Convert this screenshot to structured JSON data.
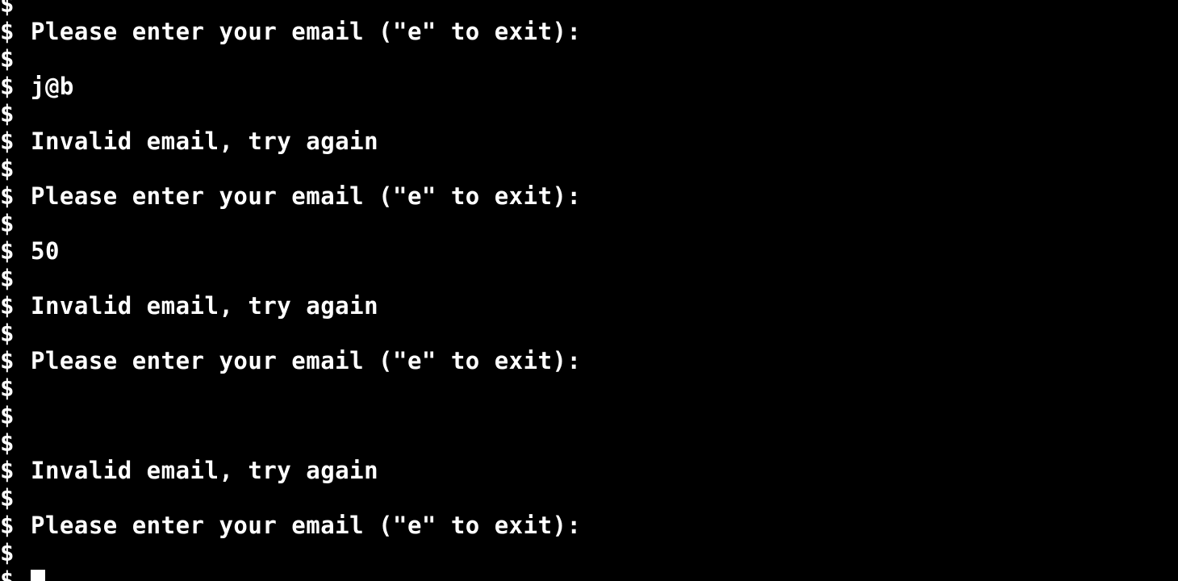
{
  "terminal": {
    "prompt_symbol": "$",
    "lines": [
      {
        "prompt": "$",
        "text": ""
      },
      {
        "prompt": "$",
        "text": "Please enter your email (\"e\" to exit):"
      },
      {
        "prompt": "$",
        "text": ""
      },
      {
        "prompt": "$",
        "text": "j@b"
      },
      {
        "prompt": "$",
        "text": ""
      },
      {
        "prompt": "$",
        "text": "Invalid email, try again"
      },
      {
        "prompt": "$",
        "text": ""
      },
      {
        "prompt": "$",
        "text": "Please enter your email (\"e\" to exit):"
      },
      {
        "prompt": "$",
        "text": ""
      },
      {
        "prompt": "$",
        "text": "50"
      },
      {
        "prompt": "$",
        "text": ""
      },
      {
        "prompt": "$",
        "text": "Invalid email, try again"
      },
      {
        "prompt": "$",
        "text": ""
      },
      {
        "prompt": "$",
        "text": "Please enter your email (\"e\" to exit):"
      },
      {
        "prompt": "$",
        "text": ""
      },
      {
        "prompt": "$",
        "text": ""
      },
      {
        "prompt": "$",
        "text": ""
      },
      {
        "prompt": "$",
        "text": "Invalid email, try again"
      },
      {
        "prompt": "$",
        "text": ""
      },
      {
        "prompt": "$",
        "text": "Please enter your email (\"e\" to exit):"
      },
      {
        "prompt": "$",
        "text": ""
      },
      {
        "prompt": "$",
        "text": ""
      }
    ],
    "cursor_line_index": 21
  },
  "colors": {
    "background": "#000000",
    "foreground": "#ffffff"
  }
}
